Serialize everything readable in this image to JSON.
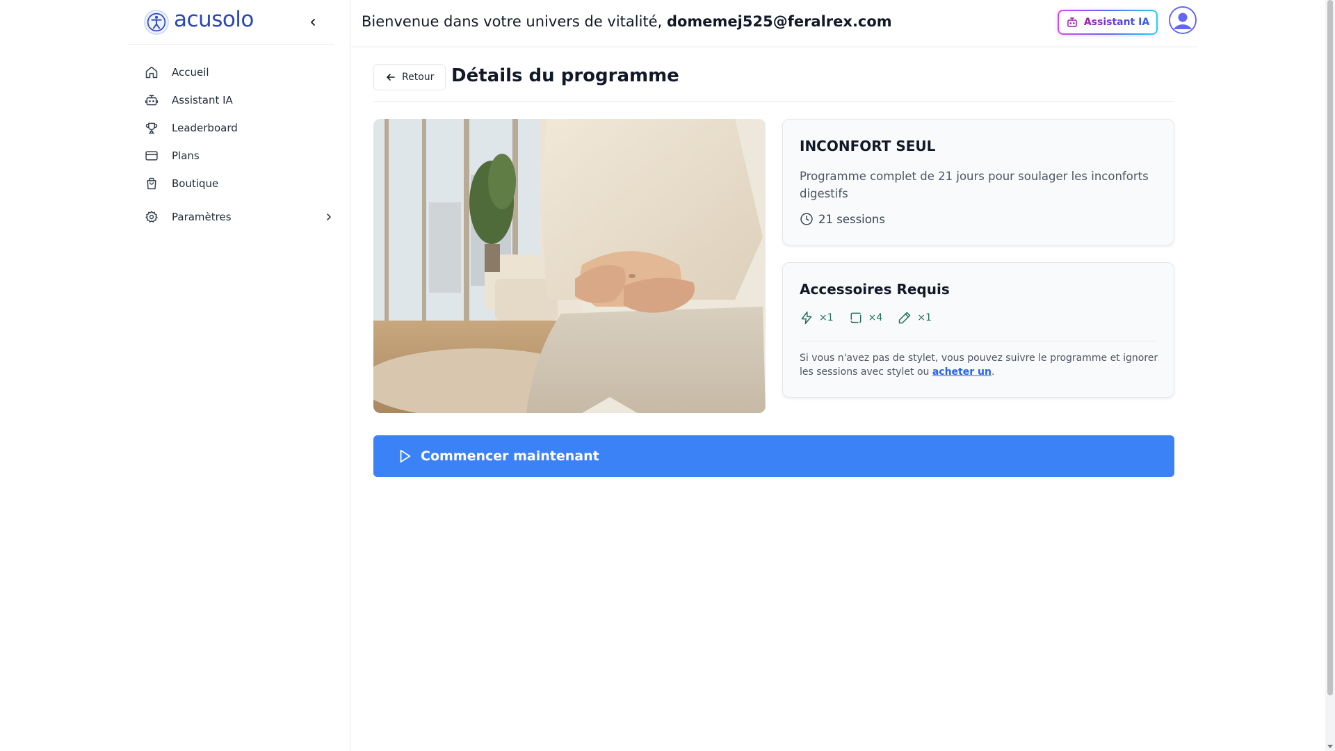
{
  "app": {
    "logo_text": "acusolo"
  },
  "sidebar": {
    "items": [
      {
        "label": "Accueil",
        "icon": "home-icon"
      },
      {
        "label": "Assistant IA",
        "icon": "bot-icon"
      },
      {
        "label": "Leaderboard",
        "icon": "trophy-icon"
      },
      {
        "label": "Plans",
        "icon": "credit-card-icon"
      },
      {
        "label": "Boutique",
        "icon": "shopping-bag-icon"
      }
    ],
    "settings_label": "Paramètres"
  },
  "header": {
    "welcome_text": "Bienvenue dans votre univers de vitalité, ",
    "user_email": "domemej525@feralrex.com",
    "ai_button_label": "Assistant IA"
  },
  "page": {
    "back_label": "Retour",
    "title": "Détails du programme"
  },
  "program": {
    "name": "INCONFORT SEUL",
    "description": "Programme complet de 21 jours pour soulager les inconforts digestifs",
    "sessions": "21 sessions"
  },
  "accessories": {
    "title": "Accessoires Requis",
    "items": [
      {
        "icon": "zap-icon",
        "qty": "×1"
      },
      {
        "icon": "square-icon",
        "qty": "×4"
      },
      {
        "icon": "pen-icon",
        "qty": "×1"
      }
    ],
    "note_before": "Si vous n'avez pas de stylet, vous pouvez suivre le programme et ignorer les sessions avec stylet ou ",
    "note_link": "acheter un",
    "note_after": "."
  },
  "cta": {
    "label": "Commencer maintenant"
  },
  "colors": {
    "primary": "#3b82f6",
    "brand": "#2b46b8",
    "accessory": "#1f6f5c"
  }
}
